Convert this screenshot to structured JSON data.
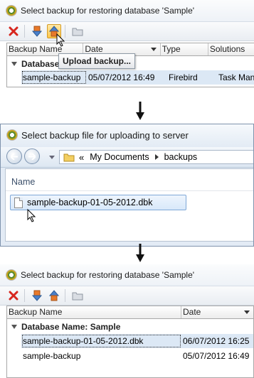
{
  "panel1": {
    "title": "Select backup for restoring database 'Sample'",
    "toolbar": {
      "delete": "delete-icon",
      "download": "download-backup-icon",
      "upload": "upload-backup-icon",
      "folder": "folder-icon"
    },
    "tooltip": "Upload backup...",
    "columns": [
      "Backup Name",
      "Date",
      "Type",
      "Solutions"
    ],
    "group_label": "Database Name: Sample",
    "rows": [
      {
        "name": "sample-backup",
        "date": "05/07/2012 16:49",
        "type": "Firebird",
        "solutions": "Task Mana"
      }
    ]
  },
  "dialog": {
    "title": "Select backup file for uploading to server",
    "breadcrumb": {
      "overflow": "«",
      "items": [
        "My Documents",
        "backups"
      ]
    },
    "column": "Name",
    "files": [
      "sample-backup-01-05-2012.dbk"
    ]
  },
  "panel3": {
    "title": "Select backup for restoring database 'Sample'",
    "columns": [
      "Backup Name",
      "Date"
    ],
    "group_label": "Database Name: Sample",
    "rows": [
      {
        "name": "sample-backup-01-05-2012.dbk",
        "date": "06/07/2012 16:25"
      },
      {
        "name": "sample-backup",
        "date": "05/07/2012 16:49"
      }
    ]
  },
  "colors": {
    "accent": "#ffc64a",
    "selection": "#dce8f5",
    "delete": "#d7261e"
  }
}
